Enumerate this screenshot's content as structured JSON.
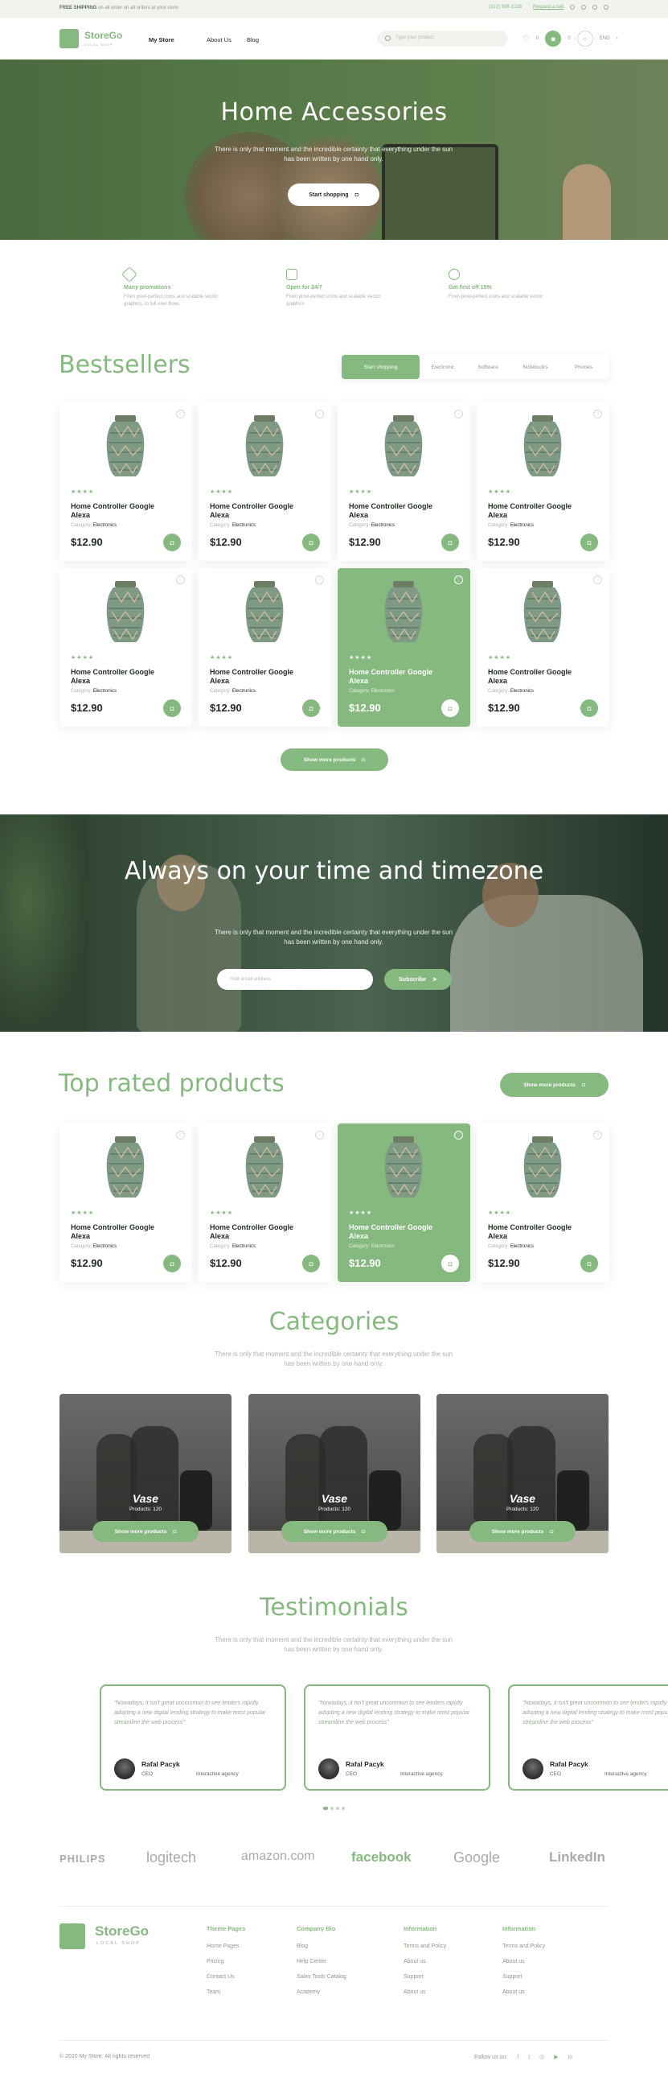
{
  "topbar": {
    "free_bold": "FREE SHIPPING",
    "free_text": "on all order on all orders at your store",
    "phone": "(312) 808-1228",
    "request": "Request a call"
  },
  "header": {
    "logo": "StoreGo",
    "logo_sub": "LOCAL SHOP",
    "nav": [
      "My Store",
      "About Us",
      "Blog"
    ],
    "search_placeholder": "Type your product",
    "wishlist_count": "0",
    "cart_count": "0",
    "lang": "ENG"
  },
  "hero": {
    "title": "Home Accessories",
    "text": "There is only that moment and the incredible certainty that everything under the sun has been written by one hand only.",
    "button": "Start shopping"
  },
  "features": [
    {
      "icon": "tag-icon",
      "title": "Many promotions",
      "text": "From pixel-perfect icons and scalable vector graphics, to full user flows"
    },
    {
      "icon": "store-icon",
      "title": "Open for 24/7",
      "text": "From pixel-perfect icons and scalable vector graphics"
    },
    {
      "icon": "smile-icon",
      "title": "Get first off 10%",
      "text": "From pixel-perfect icons and scalable vector"
    }
  ],
  "bestsellers": {
    "title": "Bestsellers",
    "tabs": [
      "Start shopping",
      "Electronic",
      "Software",
      "Notebooks",
      "Phones"
    ],
    "button": "Show more products"
  },
  "product": {
    "name": "Home Controller Google Alexa",
    "category_label": "Category:",
    "category": "Electronics",
    "price": "$12.90",
    "stars": "★★★★"
  },
  "timezone": {
    "title": "Always on your time and timezone",
    "text": "There is only that moment and the incredible certainty that everything under the sun has been written by one hand only.",
    "email_placeholder": "Your email address",
    "button": "Subscribe"
  },
  "top_rated": {
    "title": "Top rated products",
    "button": "Show more products"
  },
  "categories": {
    "title": "Categories",
    "text": "There is only that moment and the incredible certainty that everything under the sun has been written by one hand only.",
    "items": [
      {
        "name": "Vase",
        "count": "Products: 120",
        "button": "Show more products"
      },
      {
        "name": "Vase",
        "count": "Products: 120",
        "button": "Show more products"
      },
      {
        "name": "Vase",
        "count": "Products: 120",
        "button": "Show more products"
      }
    ]
  },
  "testimonials": {
    "title": "Testimonials",
    "text": "There is only that moment and the incredible certainty that everything under the sun has been written by one hand only.",
    "items": [
      {
        "quote": "\"Nowadays, it isn't great uncommon to see lenders rapidly adopting a new digital lending strategy to make most popular streamline the web process\"",
        "name": "Rafal Pacyk",
        "role": "CEO",
        "agency": "Interactive agency"
      },
      {
        "quote": "\"Nowadays, it isn't great uncommon to see lenders rapidly adopting a new digital lending strategy to make most popular streamline the web process\"",
        "name": "Rafal Pacyk",
        "role": "CEO",
        "agency": "Interactive agency"
      },
      {
        "quote": "\"Nowadays, it isn't great uncommon to see lenders rapidly adopting a new digital lending strategy to make most popular streamline the web process\"",
        "name": "Rafal Pacyk",
        "role": "CEO",
        "agency": "Interactive agency"
      }
    ]
  },
  "brands": [
    "PHILIPS",
    "logitech",
    "amazon.com",
    "facebook",
    "Google",
    "LinkedIn"
  ],
  "footer": {
    "logo": "StoreGo",
    "logo_sub": "LOCAL SHOP",
    "columns": [
      {
        "title": "Theme Pages",
        "links": [
          "Home Pages",
          "Pricing",
          "Contact Us",
          "Team"
        ]
      },
      {
        "title": "Company Bio",
        "links": [
          "Blog",
          "Help Center",
          "Sales Tools Catalog",
          "Academy"
        ]
      },
      {
        "title": "Information",
        "links": [
          "Terms and Policy",
          "About us",
          "Support",
          "About us"
        ]
      },
      {
        "title": "Information",
        "links": [
          "Terms and Policy",
          "About us",
          "Support",
          "About us"
        ]
      }
    ],
    "copyright": "© 2020 My Store. All rights reserved",
    "follow": "Follow us on:",
    "socials": [
      "f",
      "t",
      "◎",
      "▶",
      "in"
    ]
  },
  "colors": {
    "accent": "#86b97f",
    "dark": "#1f2a1f",
    "muted": "#aab3a7"
  }
}
